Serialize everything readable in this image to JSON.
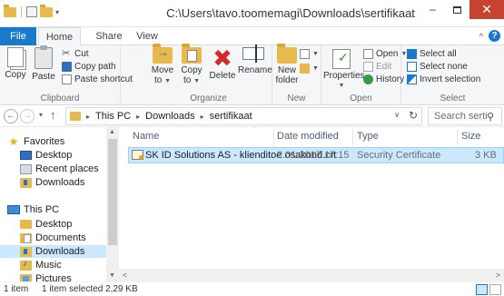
{
  "window": {
    "title": "C:\\Users\\tavo.toomemagi\\Downloads\\sertifikaat",
    "minimize_glyph": "–",
    "close_glyph": "✕"
  },
  "qat": {
    "dropdown_glyph": "▾"
  },
  "tabs": {
    "file": "File",
    "home": "Home",
    "share": "Share",
    "view": "View",
    "collapse_glyph": "^",
    "help_glyph": "?"
  },
  "ribbon": {
    "clipboard": {
      "label": "Clipboard",
      "copy": "Copy",
      "paste": "Paste",
      "cut": "Cut",
      "copy_path": "Copy path",
      "paste_shortcut": "Paste shortcut"
    },
    "organize": {
      "label": "Organize",
      "move_to": "Move",
      "move_to_2": "to",
      "copy_to": "Copy",
      "copy_to_2": "to",
      "delete": "Delete",
      "rename": "Rename"
    },
    "new": {
      "label": "New",
      "new_folder": "New",
      "new_folder_2": "folder"
    },
    "open": {
      "label": "Open",
      "properties": "Properties",
      "open": "Open",
      "edit": "Edit",
      "history": "History"
    },
    "select": {
      "label": "Select",
      "select_all": "Select all",
      "select_none": "Select none",
      "invert_selection": "Invert selection"
    }
  },
  "address": {
    "back_glyph": "←",
    "forward_glyph": "→",
    "recent_glyph": "▾",
    "up_glyph": "↑",
    "sep_glyph": "▸",
    "dropdown_glyph": "∨",
    "refresh_glyph": "↻",
    "crumbs": [
      "This PC",
      "Downloads",
      "sertifikaat"
    ],
    "search_placeholder": "Search serti..."
  },
  "nav": {
    "favorites": "Favorites",
    "desktop": "Desktop",
    "recent_places": "Recent places",
    "downloads": "Downloads",
    "this_pc": "This PC",
    "pc_desktop": "Desktop",
    "documents": "Documents",
    "pc_downloads": "Downloads",
    "music": "Music",
    "pictures": "Pictures",
    "up_glyph": "▲",
    "down_glyph": "▼"
  },
  "columns": {
    "name": "Name",
    "date_modified": "Date modified",
    "type": "Type",
    "size": "Size",
    "sort_glyph": "^"
  },
  "files": [
    {
      "name": "SK ID Solutions AS - klienditoe osakond.crt",
      "date_modified": "2.01.2017 17:15",
      "type": "Security Certificate",
      "size": "3 KB"
    }
  ],
  "hscroll": {
    "left_glyph": "<",
    "right_glyph": ">"
  },
  "status": {
    "item_count": "1 item",
    "selection": "1 item selected 2,29 KB"
  }
}
